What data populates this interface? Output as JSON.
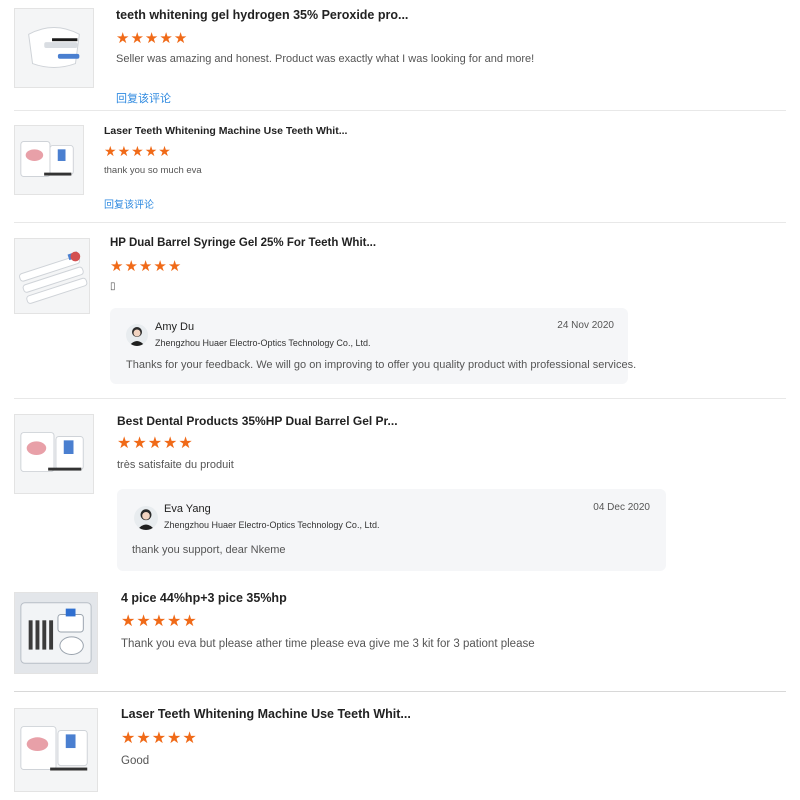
{
  "reviews": [
    {
      "title": "teeth whitening gel hydrogen 35% Peroxide pro...",
      "rating": 5,
      "comment": "Seller was amazing and honest. Product was exactly what I was looking for and more!",
      "reply_link": "回复该评论",
      "thumbnail_icon": "product-image"
    },
    {
      "title": "Laser Teeth Whitening Machine Use Teeth Whit...",
      "rating": 5,
      "comment": "thank you so much eva",
      "reply_link": "回复该评论",
      "thumbnail_icon": "product-image"
    },
    {
      "title": "HP Dual Barrel Syringe Gel 25% For Teeth Whit...",
      "rating": 5,
      "comment": "▯",
      "thumbnail_icon": "product-image",
      "seller_reply": {
        "name": "Amy Du",
        "company": "Zhengzhou Huaer Electro-Optics Technology Co., Ltd.",
        "date": "24 Nov 2020",
        "text": "Thanks for your feedback. We will go on improving to offer you quality product with professional services."
      }
    },
    {
      "title": "Best Dental Products 35%HP Dual Barrel Gel Pr...",
      "rating": 5,
      "comment": "très satisfaite du produit",
      "thumbnail_icon": "product-image",
      "seller_reply": {
        "name": "Eva Yang",
        "company": "Zhengzhou Huaer Electro-Optics Technology Co., Ltd.",
        "date": "04 Dec 2020",
        "text": "thank you support, dear Nkeme"
      }
    },
    {
      "title": "4 pice 44%hp+3 pice 35%hp",
      "rating": 5,
      "comment": "Thank you eva but please ather time please eva give me 3 kit for 3 pationt please",
      "thumbnail_icon": "product-image"
    },
    {
      "title": "Laser Teeth Whitening Machine Use Teeth Whit...",
      "rating": 5,
      "comment": "Good",
      "thumbnail_icon": "product-image"
    }
  ],
  "colors": {
    "star": "#f06a18",
    "link": "#2f8ae0",
    "divider": "#e8e8e8",
    "seller_box": "#f5f6f8"
  }
}
